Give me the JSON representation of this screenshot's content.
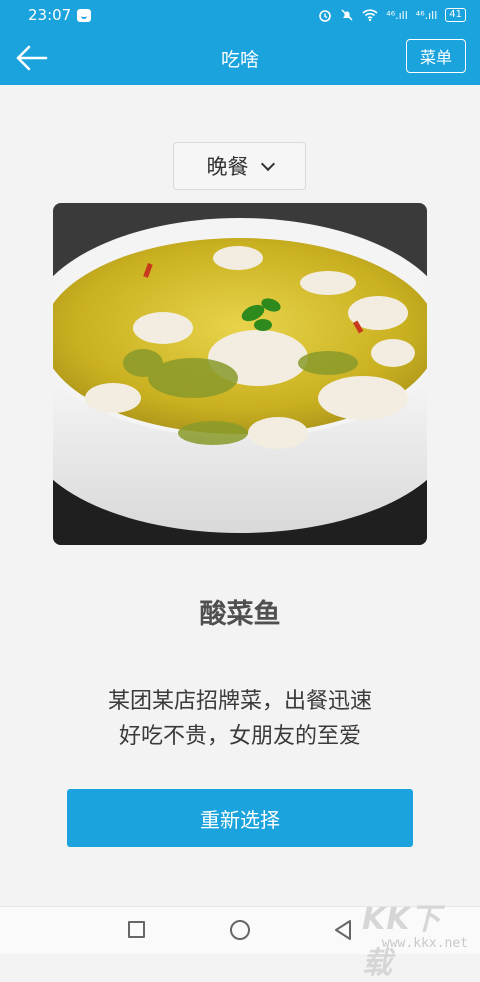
{
  "status_bar": {
    "time": "23:07",
    "signal1": "⁴⁶.ıll",
    "signal2": "⁴⁶.ıll",
    "battery": "41"
  },
  "app_bar": {
    "title": "吃啥",
    "menu_label": "菜单"
  },
  "meal_selector": {
    "value": "晚餐"
  },
  "dish": {
    "name": "酸菜鱼",
    "description_line1": "某团某店招牌菜，出餐迅速",
    "description_line2": "好吃不贵，女朋友的至爱"
  },
  "actions": {
    "reselect_label": "重新选择"
  },
  "watermark": {
    "logo": "KK下载",
    "url": "www.kkx.net"
  },
  "colors": {
    "primary": "#1ba3dd",
    "background": "#f3f3f3"
  }
}
